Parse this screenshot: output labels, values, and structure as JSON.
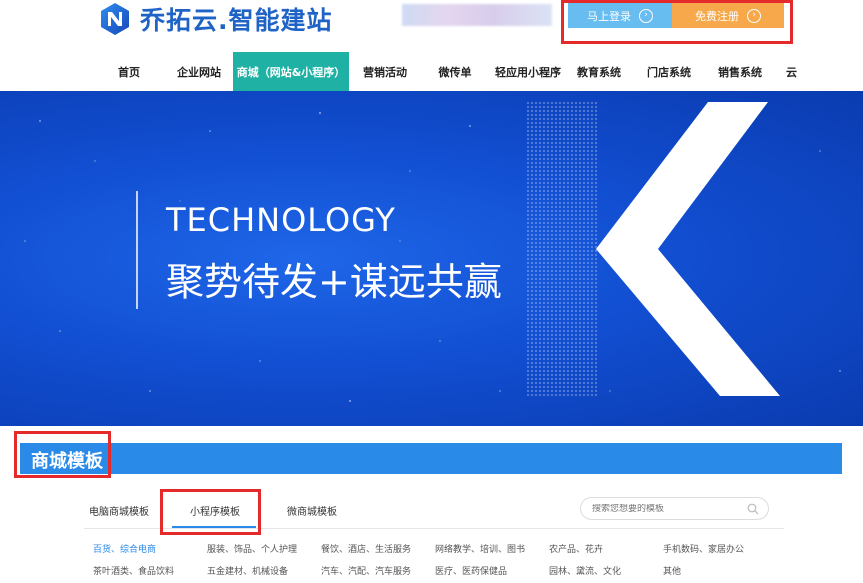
{
  "header": {
    "logo_text": "乔拓云.智能建站",
    "login_label": "马上登录",
    "register_label": "免费注册"
  },
  "nav": {
    "items": [
      "首页",
      "企业网站",
      "商城（网站&小程序）",
      "营销活动",
      "微传单",
      "轻应用小程序",
      "教育系统",
      "门店系统",
      "销售系统",
      "云"
    ],
    "active_index": 2
  },
  "banner": {
    "tagline": "TECHNOLOGY",
    "slogan": "聚势待发+谋远共赢"
  },
  "section": {
    "title": "商城模板",
    "tabs": [
      "电脑商城模板",
      "小程序模板",
      "微商城模板"
    ],
    "active_tab": 1,
    "search_placeholder": "搜索您想要的模板"
  },
  "categories": {
    "row1": [
      "百货、综合电商",
      "服装、饰品、个人护理",
      "餐饮、酒店、生活服务",
      "网络教学、培训、图书",
      "农产品、花卉",
      "手机数码、家居办公"
    ],
    "row2": [
      "茶叶酒类、食品饮料",
      "五金建材、机械设备",
      "汽车、汽配、汽车服务",
      "医疗、医药保健品",
      "园林、黛流、文化",
      "其他"
    ]
  },
  "colors": {
    "brand": "#1f63c6",
    "nav_active": "#1fb1a4",
    "login_btn": "#68bdf0",
    "register_btn": "#f6a84b",
    "section_bar": "#2a8ae8",
    "annotation_red": "#e42a2a"
  }
}
